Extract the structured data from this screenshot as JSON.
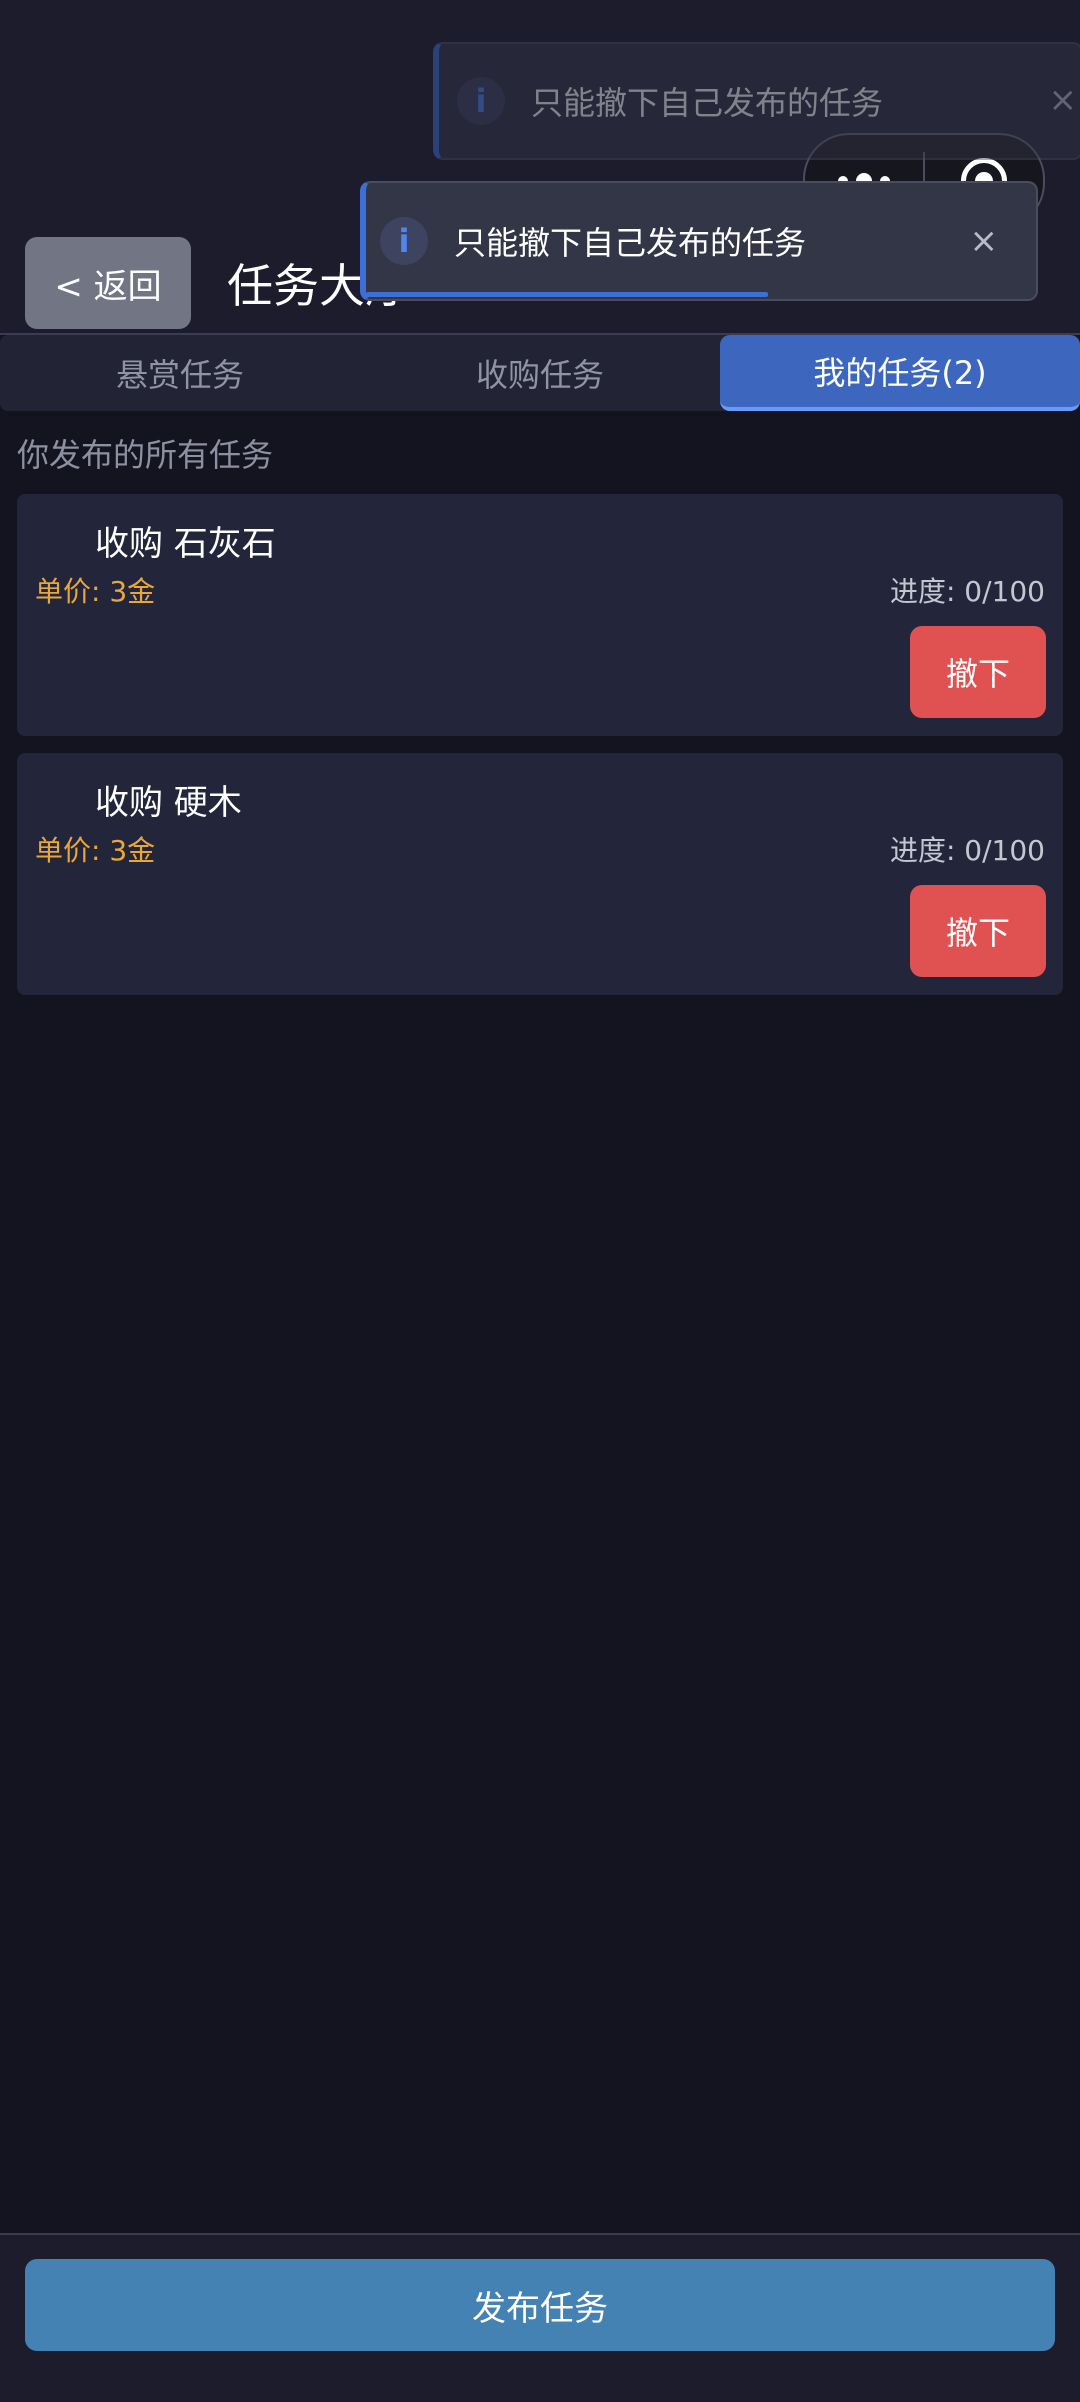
{
  "header": {
    "back_label": "< 返回",
    "title": "任务大厅"
  },
  "toasts": [
    {
      "message": "只能撤下自己发布的任务",
      "icon": "info-icon",
      "close": "×"
    },
    {
      "message": "只能撤下自己发布的任务",
      "icon": "info-icon",
      "close": "×",
      "progress": 0.6
    }
  ],
  "tabs": [
    {
      "label": "悬赏任务",
      "active": false
    },
    {
      "label": "收购任务",
      "active": false
    },
    {
      "label": "我的任务(2)",
      "active": true
    }
  ],
  "section_label": "你发布的所有任务",
  "tasks": [
    {
      "title": "收购 石灰石",
      "price": "单价: 3金",
      "progress": "进度: 0/100",
      "action": "撤下"
    },
    {
      "title": "收购 硬木",
      "price": "单价: 3金",
      "progress": "进度: 0/100",
      "action": "撤下"
    }
  ],
  "footer": {
    "publish_label": "发布任务"
  },
  "colors": {
    "accent": "#3d67bf",
    "danger": "#e05252",
    "price": "#e8a73c",
    "primary_button": "#4482b4"
  }
}
